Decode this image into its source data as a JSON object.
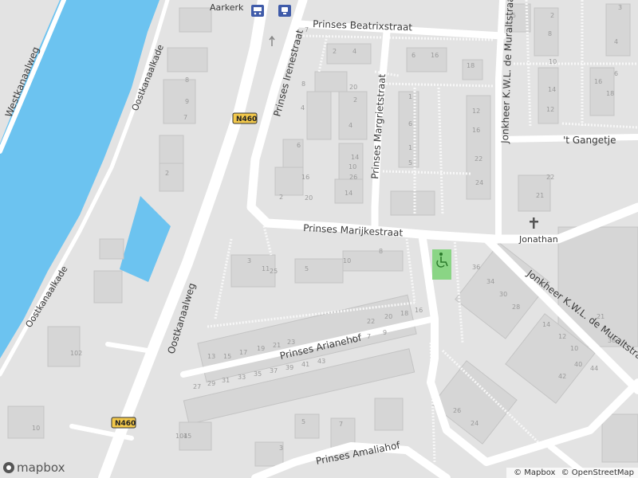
{
  "map": {
    "colors": {
      "background": "#e3e3e3",
      "water": "#6cc3f0",
      "road": "#ffffff",
      "building": "#d6d6d6",
      "building_stroke": "#c4c4c4",
      "path": "#f8f8f8",
      "park": "#7fd37a"
    },
    "street_labels": {
      "westkanaalweg": "Westkanaalweg",
      "oostkanaalkade_top": "Oostkanaalkade",
      "oostkanaalkade_bottom": "Oostkanaalkade",
      "oostkanaalweg": "Oostkanaalweg",
      "prinses_irenestraat": "Prinses Irenestraat",
      "prinses_beatrixstraat": "Prinses Beatrixstraat",
      "prinses_margrietstraat": "Prinses Margrietstraat",
      "prinses_marijkestraat": "Prinses Marijkestraat",
      "prinses_arianehof": "Prinses Arianehof",
      "prinses_amaliahof": "Prinses Amaliahof",
      "jonkheer_top": "Jonkheer K.W.L. de Muraltstraat",
      "jonkheer_diag": "Jonkheer K.W.L. de Muraltstraat",
      "gangetje": "'t Gangetje"
    },
    "road_shields": {
      "top": "N460",
      "bottom": "N460"
    },
    "pois": {
      "aarkerk": "Aarkerk",
      "jonathan": "Jonathan"
    },
    "house_numbers": [
      "9",
      "7",
      "2",
      "8",
      "4",
      "6",
      "8",
      "10",
      "14",
      "16",
      "2",
      "1",
      "4",
      "16",
      "12",
      "6",
      "22",
      "20",
      "24",
      "26",
      "2",
      "1",
      "5",
      "20",
      "18",
      "16",
      "14",
      "12",
      "10",
      "8",
      "6",
      "4",
      "2",
      "3",
      "5",
      "7",
      "2",
      "4",
      "6",
      "16",
      "18",
      "14",
      "22",
      "21",
      "10",
      "8",
      "5",
      "3",
      "11",
      "25",
      "13",
      "15",
      "17",
      "19",
      "21",
      "23",
      "9",
      "7",
      "4",
      "27",
      "29",
      "31",
      "33",
      "35",
      "37",
      "39",
      "41",
      "43",
      "22",
      "20",
      "18",
      "16",
      "14",
      "12",
      "10",
      "21",
      "44",
      "42",
      "40",
      "38",
      "36",
      "34",
      "30",
      "28",
      "26",
      "24",
      "15",
      "10",
      "102",
      "104",
      "3",
      "5",
      "7"
    ]
  },
  "attribution": {
    "mapbox": "© Mapbox",
    "osm": "© OpenStreetMap"
  },
  "logo": {
    "text": "mapbox"
  },
  "icons": {
    "bus_stop": "bus-icon",
    "train_stop": "train-icon",
    "church": "church-cross-icon",
    "wheelchair": "wheelchair-icon",
    "oneway_arrow": "arrow-up-icon"
  }
}
